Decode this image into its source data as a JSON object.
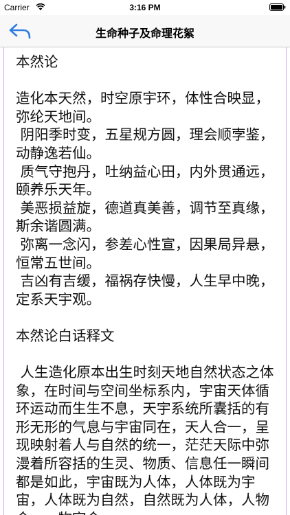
{
  "status_bar": {
    "carrier": "Carrier",
    "time": "3:16 PM"
  },
  "nav": {
    "title": "生命种子及命理花絮",
    "back_icon": "back-arrow-icon",
    "accent_color": "#2f7de1"
  },
  "content": {
    "text": "本然论\n\n造化本天然，时空原宇环，体性合映显，弥纶天地间。\n 阴阳季时变，五星规方圆，理会顺孛鉴，动静逸若仙。\n 质气守抱丹，吐纳益心田，内外贯通远，颐养乐天年。\n 美恶损益旋，德道真美善，调节至真缘，斯余谐圆满。\n 弥离一念闪，参差心性宣，因果局异悬，恒常五世间。\n 吉凶有吉缓，福祸存快慢，人生早中晚，定系天宇观。\n\n本然论白话释文\n\n 人生造化原本出生时刻天地自然状态之体象，在时间与空间坐标系内，宇宙天体循环运动而生生不息，天宇系统所囊括的有形无形的气息与宇宙同在，天人合一，呈现映射着人与自然的统一，茫茫天际中弥漫着所容括的生灵、物质、信息任一瞬间都是如此，宇宙既为人体，人体既为宇宙，人体既为自然，自然既为人体，人物合一，物宇合一。"
  }
}
